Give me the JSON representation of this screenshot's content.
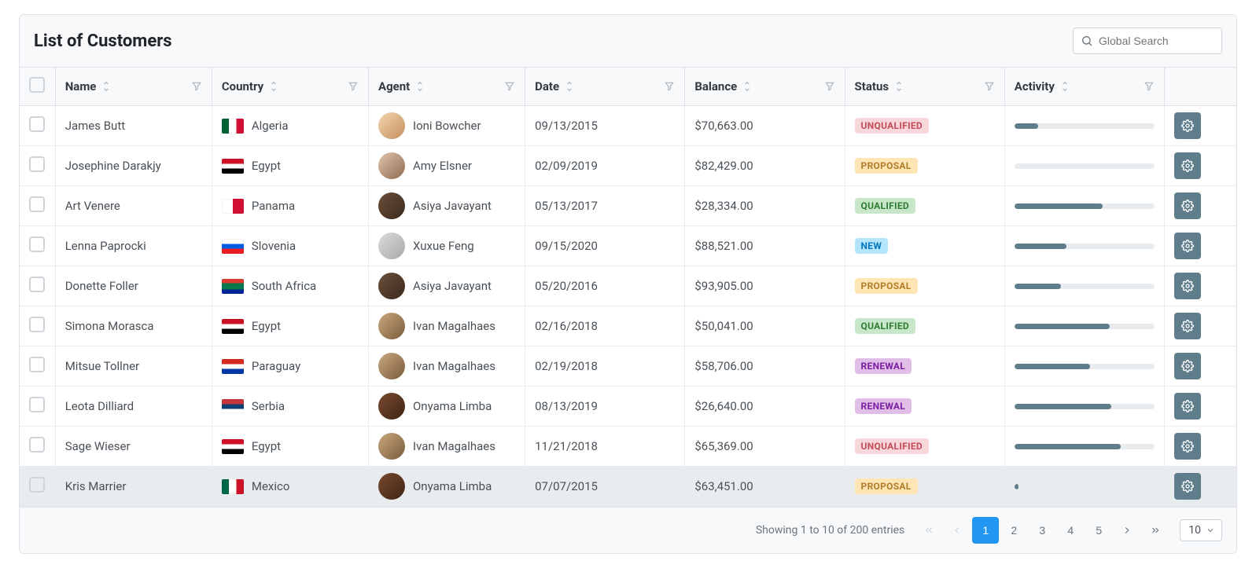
{
  "header": {
    "title": "List of Customers",
    "search_placeholder": "Global Search"
  },
  "columns": {
    "name": "Name",
    "country": "Country",
    "agent": "Agent",
    "date": "Date",
    "balance": "Balance",
    "status": "Status",
    "activity": "Activity"
  },
  "statuses": {
    "unqualified": "UNQUALIFIED",
    "proposal": "PROPOSAL",
    "qualified": "QUALIFIED",
    "new": "NEW",
    "renewal": "RENEWAL"
  },
  "rows": [
    {
      "name": "James Butt",
      "country": "Algeria",
      "flag": "linear-gradient(90deg,#006233 33%,#fff 33% 66%,#d21034 66%)",
      "agent": "Ioni Bowcher",
      "avatar": "linear-gradient(135deg,#f6d7b0,#c28e5c)",
      "date": "09/13/2015",
      "balance": "$70,663.00",
      "status": "unqualified",
      "activity": 17
    },
    {
      "name": "Josephine Darakjy",
      "country": "Egypt",
      "flag": "linear-gradient(#ce1126 33%,#fff 33% 66%,#000 66%)",
      "agent": "Amy Elsner",
      "avatar": "linear-gradient(135deg,#e0c4ac,#8e6b50)",
      "date": "02/09/2019",
      "balance": "$82,429.00",
      "status": "proposal",
      "activity": 0
    },
    {
      "name": "Art Venere",
      "country": "Panama",
      "flag": "linear-gradient(90deg,#fff 50%,#d21034 50%),linear-gradient(#005aa7 50%,#fff 50%)",
      "agent": "Asiya Javayant",
      "avatar": "linear-gradient(135deg,#6b4f3a,#3a2a1e)",
      "date": "05/13/2017",
      "balance": "$28,334.00",
      "status": "qualified",
      "activity": 63
    },
    {
      "name": "Lenna Paprocki",
      "country": "Slovenia",
      "flag": "linear-gradient(#fff 33%,#005ce5 33% 66%,#ed1c24 66%)",
      "agent": "Xuxue Feng",
      "avatar": "linear-gradient(135deg,#dcdcdc,#a8a8a8)",
      "date": "09/15/2020",
      "balance": "$88,521.00",
      "status": "new",
      "activity": 37
    },
    {
      "name": "Donette Foller",
      "country": "South Africa",
      "flag": "linear-gradient(#de3831 30%,#007a4d 30% 70%,#002395 70%)",
      "agent": "Asiya Javayant",
      "avatar": "linear-gradient(135deg,#6b4f3a,#3a2a1e)",
      "date": "05/20/2016",
      "balance": "$93,905.00",
      "status": "proposal",
      "activity": 33
    },
    {
      "name": "Simona Morasca",
      "country": "Egypt",
      "flag": "linear-gradient(#ce1126 33%,#fff 33% 66%,#000 66%)",
      "agent": "Ivan Magalhaes",
      "avatar": "linear-gradient(135deg,#c9a87c,#7a5c3d)",
      "date": "02/16/2018",
      "balance": "$50,041.00",
      "status": "qualified",
      "activity": 68
    },
    {
      "name": "Mitsue Tollner",
      "country": "Paraguay",
      "flag": "linear-gradient(#d52b1e 33%,#fff 33% 66%,#0038a8 66%)",
      "agent": "Ivan Magalhaes",
      "avatar": "linear-gradient(135deg,#c9a87c,#7a5c3d)",
      "date": "02/19/2018",
      "balance": "$58,706.00",
      "status": "renewal",
      "activity": 54
    },
    {
      "name": "Leota Dilliard",
      "country": "Serbia",
      "flag": "linear-gradient(#c6363c 33%,#0c4076 33% 66%,#fff 66%)",
      "agent": "Onyama Limba",
      "avatar": "linear-gradient(135deg,#7a4a2e,#3d2415)",
      "date": "08/13/2019",
      "balance": "$26,640.00",
      "status": "renewal",
      "activity": 69
    },
    {
      "name": "Sage Wieser",
      "country": "Egypt",
      "flag": "linear-gradient(#ce1126 33%,#fff 33% 66%,#000 66%)",
      "agent": "Ivan Magalhaes",
      "avatar": "linear-gradient(135deg,#c9a87c,#7a5c3d)",
      "date": "11/21/2018",
      "balance": "$65,369.00",
      "status": "unqualified",
      "activity": 76
    },
    {
      "name": "Kris Marrier",
      "country": "Mexico",
      "flag": "linear-gradient(90deg,#006847 33%,#fff 33% 66%,#ce1126 66%)",
      "agent": "Onyama Limba",
      "avatar": "linear-gradient(135deg,#7a4a2e,#3d2415)",
      "date": "07/07/2015",
      "balance": "$63,451.00",
      "status": "proposal",
      "activity": 3,
      "hovered": true
    }
  ],
  "footer": {
    "entries_text": "Showing 1 to 10 of 200 entries",
    "pages": [
      "1",
      "2",
      "3",
      "4",
      "5"
    ],
    "active_page": "1",
    "rows_per_page": "10"
  }
}
